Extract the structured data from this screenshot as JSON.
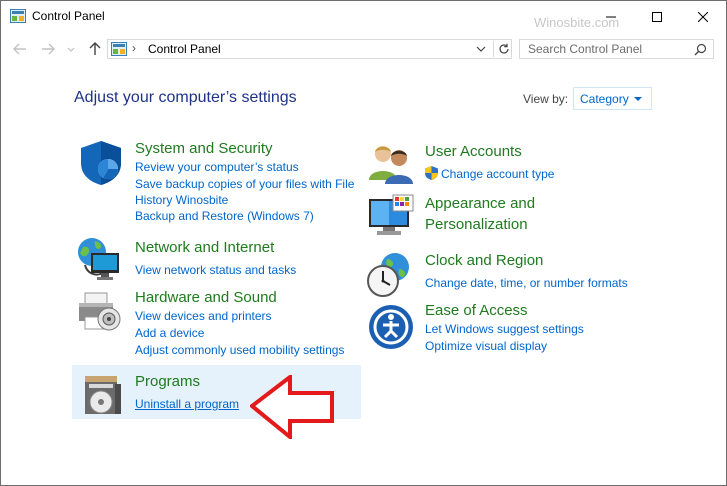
{
  "window": {
    "title": "Control Panel",
    "watermark": "Winosbite.com"
  },
  "nav": {
    "breadcrumb": "Control Panel",
    "search_placeholder": "Search Control Panel"
  },
  "header": {
    "heading": "Adjust your computer’s settings",
    "view_by_label": "View by:",
    "view_by_value": "Category"
  },
  "categories": {
    "system": {
      "title": "System and Security",
      "links": [
        "Review your computer’s status",
        "Save backup copies of your files with File",
        "History Winosbite",
        "Backup and Restore (Windows 7)"
      ]
    },
    "network": {
      "title": "Network and Internet",
      "links": [
        "View network status and tasks"
      ]
    },
    "hardware": {
      "title": "Hardware and Sound",
      "links": [
        "View devices and printers",
        "Add a device",
        "Adjust commonly used mobility settings"
      ]
    },
    "programs": {
      "title": "Programs",
      "links": [
        "Uninstall a program"
      ]
    },
    "users": {
      "title": "User Accounts",
      "links": [
        "Change account type"
      ]
    },
    "appearance": {
      "title_line1": "Appearance and",
      "title_line2": "Personalization",
      "links": []
    },
    "clock": {
      "title": "Clock and Region",
      "links": [
        "Change date, time, or number formats"
      ]
    },
    "ease": {
      "title": "Ease of Access",
      "links": [
        "Let Windows suggest settings",
        "Optimize visual display"
      ]
    }
  },
  "colors": {
    "link": "#0066cc",
    "category_title": "#1e7b1e",
    "heading": "#1e3287",
    "highlight": "#e5f1fb",
    "annotation_arrow": "#e3191c"
  },
  "icons": [
    "control-panel-icon",
    "minimize-icon",
    "maximize-icon",
    "close-icon",
    "back-arrow-icon",
    "forward-arrow-icon",
    "recent-dropdown-icon",
    "up-arrow-icon",
    "chevron-down-icon",
    "refresh-icon",
    "search-icon",
    "shield-icon",
    "globe-network-icon",
    "printer-icon",
    "programs-icon",
    "users-icon",
    "uac-shield-icon",
    "display-icon",
    "clock-globe-icon",
    "ease-of-access-icon",
    "red-arrow-annotation"
  ]
}
